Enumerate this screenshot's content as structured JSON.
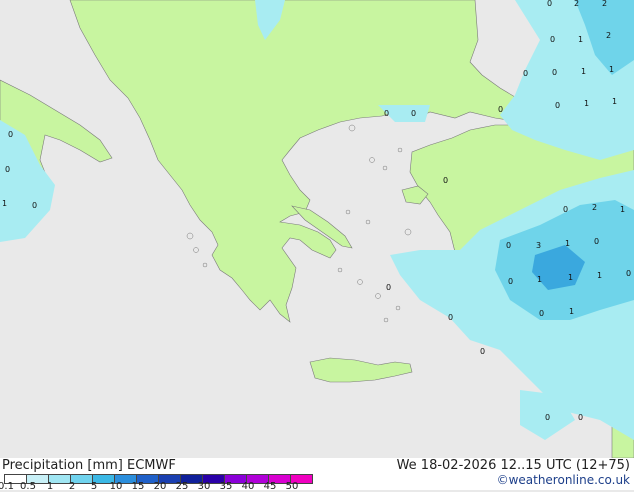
{
  "footer": {
    "title": "Precipitation [mm] ECMWF",
    "datetime": "We 18-02-2026 12..15 UTC (12+75)",
    "credit": "©weatheronline.co.uk"
  },
  "colors": {
    "sea": "#e9e9e9",
    "land": "#c8f5a0",
    "precip_light": "#a8ecf2",
    "precip_mid": "#6fd4ea",
    "precip_heavy": "#3aa8de"
  },
  "legend": {
    "labels": [
      "0.1",
      "0.5",
      "1",
      "2",
      "5",
      "10",
      "15",
      "20",
      "25",
      "30",
      "35",
      "40",
      "45",
      "50"
    ],
    "colors": [
      "#ffffff",
      "#c8f0f7",
      "#a0e6f3",
      "#70d3ee",
      "#3bb8e5",
      "#2b8edc",
      "#2060c8",
      "#1a3fb0",
      "#10209a",
      "#2a00a8",
      "#8a00d8",
      "#b000d8",
      "#d800d0",
      "#f000c0"
    ]
  },
  "precip_values": [
    "0",
    "2",
    "2",
    "0",
    "1",
    "2",
    "0",
    "0",
    "1",
    "1",
    "0",
    "1",
    "1",
    "0",
    "0",
    "0",
    "0",
    "0",
    "0",
    "0",
    "1",
    "0",
    "2",
    "1",
    "3",
    "1",
    "0",
    "0",
    "1",
    "1",
    "1",
    "0",
    "0",
    "0",
    "1",
    "0",
    "0",
    "0",
    "0",
    "0"
  ]
}
